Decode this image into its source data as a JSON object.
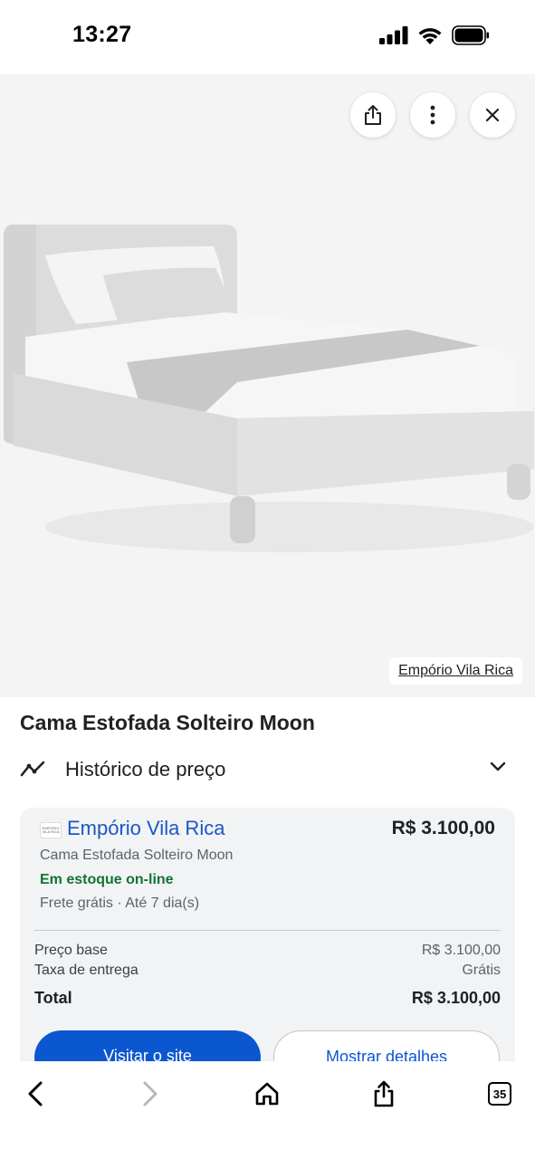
{
  "status_bar": {
    "time": "13:27",
    "icons": [
      "signal-icon",
      "wifi-icon",
      "battery-icon"
    ]
  },
  "hero": {
    "source_label": "Empório Vila Rica",
    "actions": [
      "share-icon",
      "more-vert-icon",
      "close-icon"
    ]
  },
  "product": {
    "title": "Cama Estofada Solteiro Moon"
  },
  "price_history": {
    "label": "Histórico de preço"
  },
  "offer": {
    "store_logo_text": "EMPÓRIO VILA RICA",
    "store_name": "Empório Vila Rica",
    "price": "R$ 3.100,00",
    "product_name": "Cama Estofada Solteiro Moon",
    "stock": "Em estoque on-line",
    "shipping": "Frete grátis · Até 7 dia(s)",
    "breakdown": {
      "base_label": "Preço base",
      "base_value": "R$ 3.100,00",
      "fee_label": "Taxa de entrega",
      "fee_value": "Grátis",
      "total_label": "Total",
      "total_value": "R$ 3.100,00"
    },
    "visit_button": "Visitar o site",
    "details_button": "Mostrar detalhes"
  },
  "bottom_bar": {
    "tab_count": "35"
  },
  "colors": {
    "link_blue": "#1a57c6",
    "primary_button": "#0b57d0",
    "stock_green": "#137333",
    "card_bg": "#f1f3f4"
  }
}
